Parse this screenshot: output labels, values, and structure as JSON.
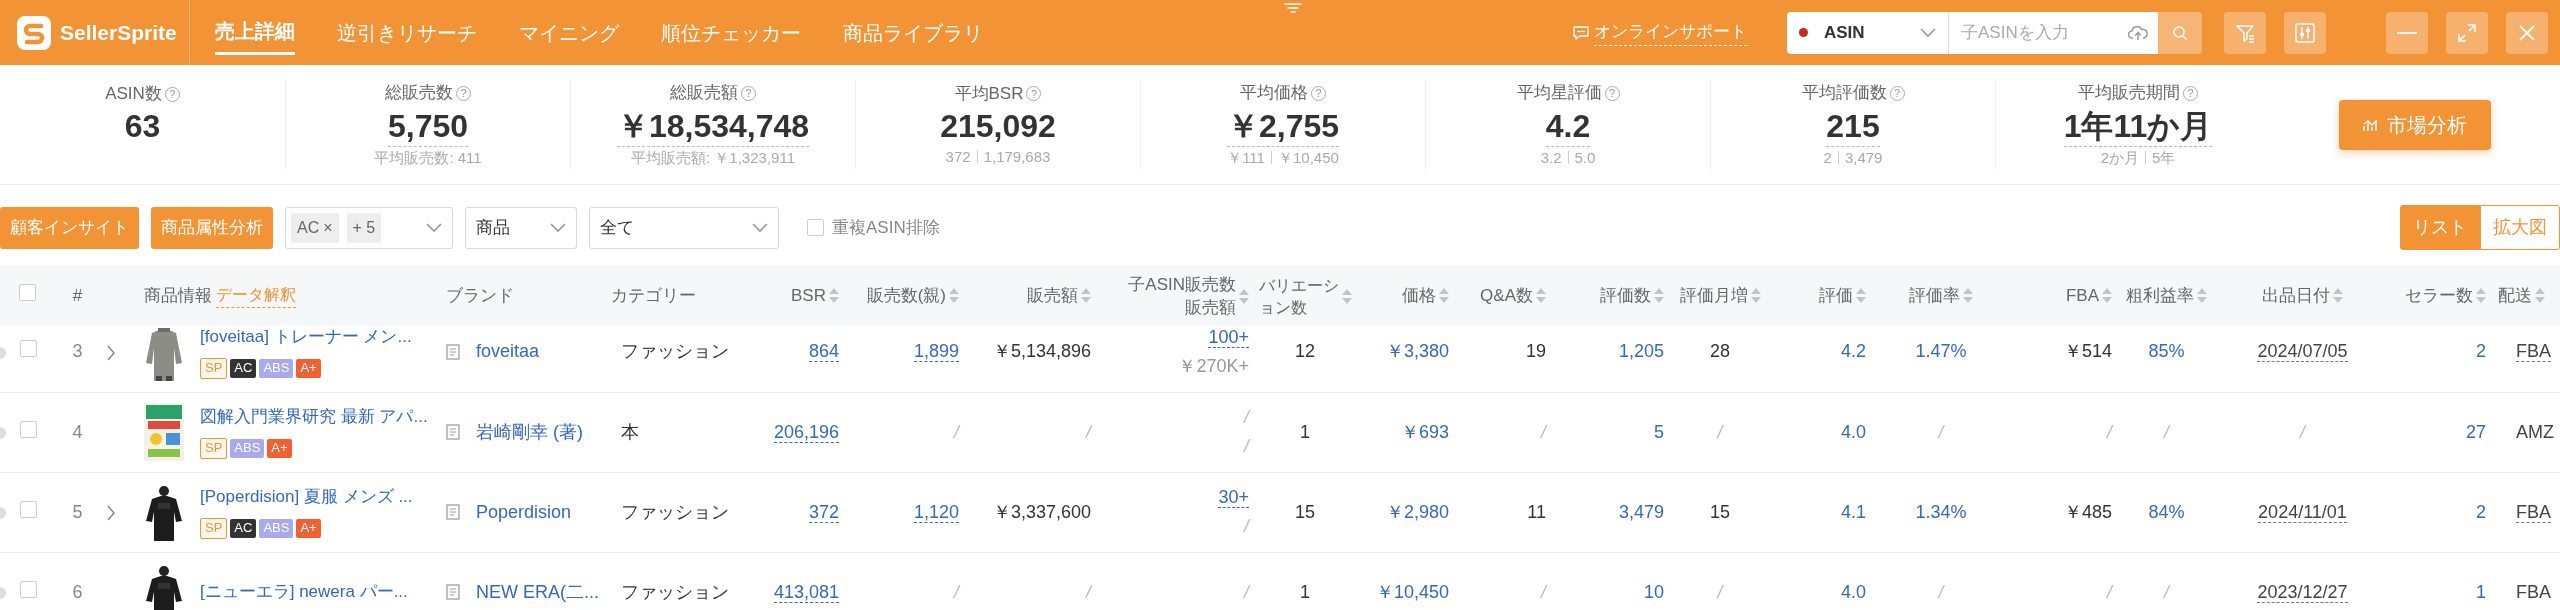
{
  "logo": {
    "text": "SellerSprite"
  },
  "nav": [
    {
      "label": "売上詳細",
      "selected": true
    },
    {
      "label": "逆引きリサーチ",
      "selected": false
    },
    {
      "label": "マイニング",
      "selected": false
    },
    {
      "label": "順位チェッカー",
      "selected": false
    },
    {
      "label": "商品ライブラリ",
      "selected": false
    }
  ],
  "support_link": "オンラインサポート",
  "search": {
    "scope": "ASIN",
    "placeholder": "子ASINを入力"
  },
  "stats": [
    {
      "label": "ASIN数",
      "help": "?",
      "value": "63",
      "underlined": false
    },
    {
      "label": "総販売数",
      "help": "?",
      "value": "5,750",
      "underlined": true,
      "sub": [
        "平均販売数: 411"
      ]
    },
    {
      "label": "総販売額",
      "help": "?",
      "value": "￥18,534,748",
      "underlined": true,
      "sub": [
        "平均販売額: ￥1,323,911"
      ]
    },
    {
      "label": "平均BSR",
      "help": "?",
      "value": "215,092",
      "underlined": false,
      "sub": [
        "372",
        "1,179,683"
      ]
    },
    {
      "label": "平均価格",
      "help": "?",
      "value": "￥2,755",
      "underlined": true,
      "sub": [
        "￥111",
        "￥10,450"
      ]
    },
    {
      "label": "平均星評価",
      "help": "?",
      "value": "4.2",
      "underlined": true,
      "sub": [
        "3.2",
        "5.0"
      ]
    },
    {
      "label": "平均評価数",
      "help": "?",
      "value": "215",
      "underlined": true,
      "sub": [
        "2",
        "3,479"
      ]
    },
    {
      "label": "平均販売期間",
      "help": "?",
      "value": "1年11か月",
      "underlined": true,
      "sub": [
        "2か月",
        "5年"
      ]
    }
  ],
  "market_button": "市場分析",
  "filters": {
    "buttons": [
      "顧客インサイト",
      "商品属性分析"
    ],
    "tag_select": {
      "tags": [
        {
          "label": "AC",
          "remove": "×"
        }
      ],
      "more": "+ 5"
    },
    "selects": [
      {
        "value": "商品"
      },
      {
        "value": "全て"
      }
    ],
    "dedupe": {
      "label": "重複ASIN排除",
      "checked": false
    }
  },
  "view_toggle": [
    {
      "label": "リスト",
      "selected": true
    },
    {
      "label": "拡大図",
      "selected": false
    }
  ],
  "table": {
    "select_all_checked": false,
    "columns": [
      {
        "label": "#",
        "kind": "index"
      },
      {
        "label": "商品情報",
        "link": "データ解釈",
        "kind": "product"
      },
      {
        "label": "ブランド",
        "kind": "brand"
      },
      {
        "label": "カテゴリー",
        "kind": "text"
      },
      {
        "label": "BSR",
        "kind": "link"
      },
      {
        "label": "販売数(親)",
        "kind": "link"
      },
      {
        "label": "販売額",
        "kind": "plain"
      },
      {
        "label": "子ASIN販売数",
        "label2": "販売額",
        "kind": "child"
      },
      {
        "label": "バリエーション数",
        "kind": "center"
      },
      {
        "label": "価格",
        "kind": "blue"
      },
      {
        "label": "Q&A数",
        "kind": "plain"
      },
      {
        "label": "評価数",
        "kind": "blue"
      },
      {
        "label": "評価月増",
        "kind": "center"
      },
      {
        "label": "評価",
        "kind": "blue"
      },
      {
        "label": "評価率",
        "kind": "bluecenter"
      },
      {
        "label": "FBA",
        "kind": "plain"
      },
      {
        "label": "粗利益率",
        "kind": "bluecenter"
      },
      {
        "label": "出品日付",
        "kind": "date"
      },
      {
        "label": "セラー数",
        "kind": "blue"
      },
      {
        "label": "配送",
        "kind": "delivery"
      }
    ],
    "rows": [
      {
        "checked": false,
        "expandable": true,
        "delivery_underlined": true,
        "cells": [
          "3",
          {
            "title": "[foveitaa] トレーナー メン...",
            "badges": [
              {
                "label": "SP",
                "kind": "sp"
              },
              {
                "label": "AC",
                "kind": "ac"
              },
              {
                "label": "ABS",
                "kind": "abs"
              },
              {
                "label": "A+",
                "kind": "aplus"
              }
            ]
          },
          "foveitaa",
          "ファッション",
          "864",
          "1,899",
          "￥5,134,896",
          [
            "100+",
            "￥270K+"
          ],
          "12",
          "￥3,380",
          "19",
          "1,205",
          "28",
          "4.2",
          "1.47%",
          "￥514",
          "85%",
          "2024/07/05",
          "2",
          "FBA"
        ]
      },
      {
        "checked": false,
        "expandable": false,
        "delivery_underlined": false,
        "cells": [
          "4",
          {
            "title": "図解入門業界研究 最新 アパ...",
            "badges": [
              {
                "label": "SP",
                "kind": "sp"
              },
              {
                "label": "ABS",
                "kind": "abs"
              },
              {
                "label": "A+",
                "kind": "aplus"
              }
            ]
          },
          "岩崎剛幸 (著)",
          "本",
          "206,196",
          {
            "empty": "/"
          },
          {
            "empty": "/"
          },
          [
            {
              "empty": "/"
            },
            {
              "empty": "/"
            }
          ],
          "1",
          "￥693",
          {
            "empty": "/"
          },
          "5",
          {
            "empty": "/"
          },
          "4.0",
          {
            "empty": "/"
          },
          {
            "empty": "/"
          },
          {
            "empty": "/"
          },
          {
            "empty": "/"
          },
          "27",
          "AMZ"
        ]
      },
      {
        "checked": false,
        "expandable": true,
        "delivery_underlined": true,
        "cells": [
          "5",
          {
            "title": "[Poperdision] 夏服 メンズ ...",
            "badges": [
              {
                "label": "SP",
                "kind": "sp"
              },
              {
                "label": "AC",
                "kind": "ac"
              },
              {
                "label": "ABS",
                "kind": "abs"
              },
              {
                "label": "A+",
                "kind": "aplus"
              }
            ]
          },
          "Poperdision",
          "ファッション",
          "372",
          "1,120",
          "￥3,337,600",
          [
            "30+",
            {
              "empty": "/"
            }
          ],
          "15",
          "￥2,980",
          "11",
          "3,479",
          "15",
          "4.1",
          "1.34%",
          "￥485",
          "84%",
          "2024/11/01",
          "2",
          "FBA"
        ]
      },
      {
        "checked": false,
        "expandable": false,
        "delivery_underlined": false,
        "cells": [
          "6",
          {
            "title": "[ニューエラ] newera パー..."
          },
          "NEW ERA(二...",
          "ファッション",
          "413,081",
          {
            "empty": "/"
          },
          {
            "empty": "/"
          },
          [
            {
              "empty": "/"
            }
          ],
          "1",
          "￥10,450",
          {
            "empty": "/"
          },
          "10",
          {
            "empty": "/"
          },
          "4.0",
          {
            "empty": "/"
          },
          {
            "empty": "/"
          },
          {
            "empty": "/"
          },
          "2023/12/27",
          "1",
          "FBA"
        ]
      }
    ]
  }
}
